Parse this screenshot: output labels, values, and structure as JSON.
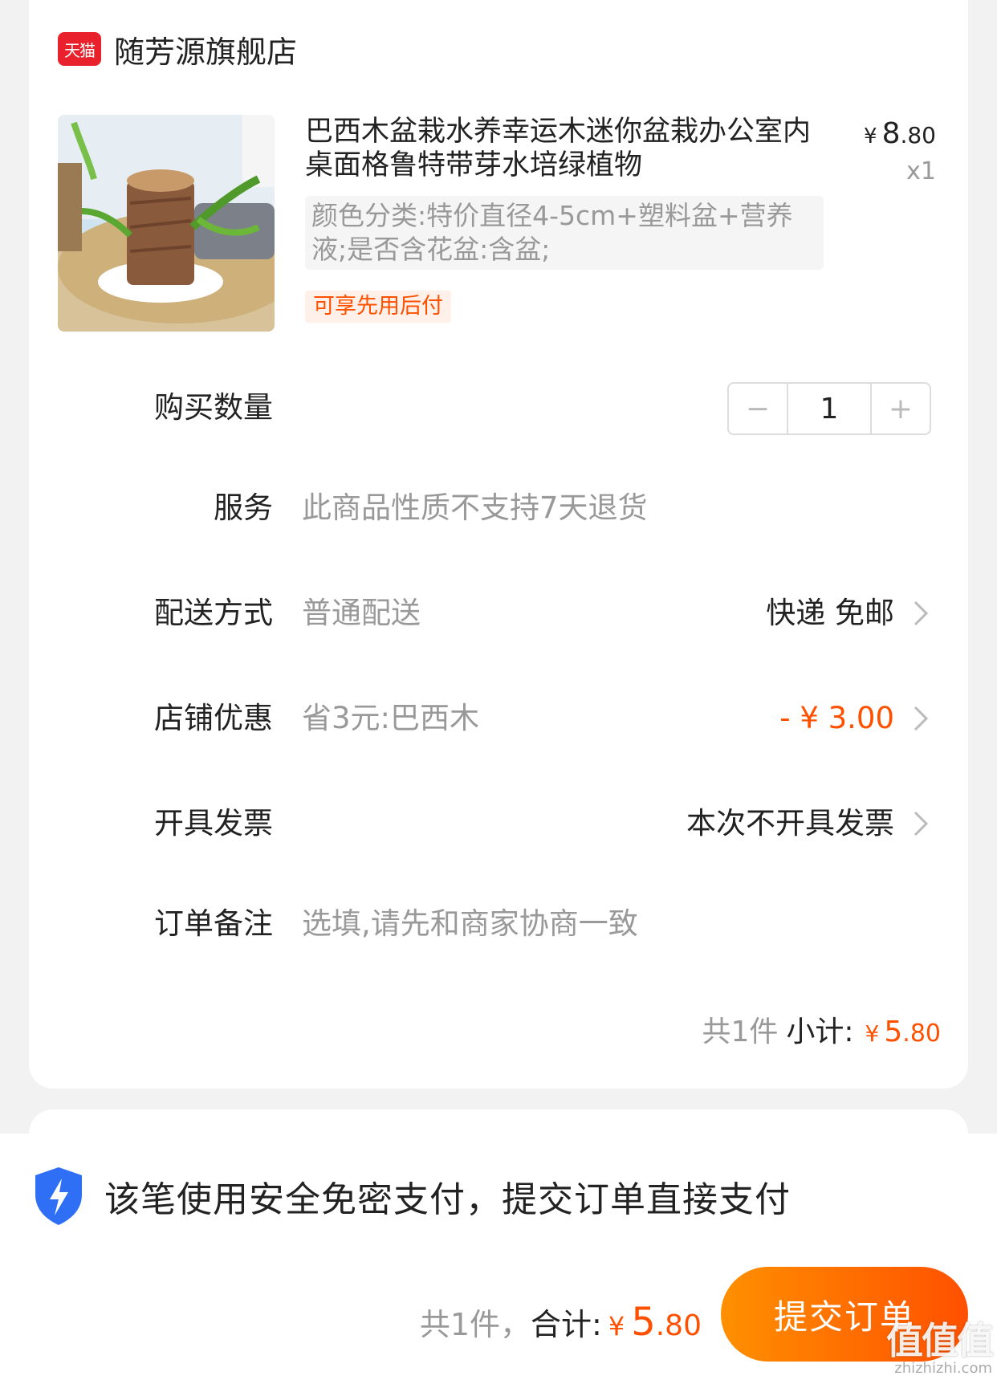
{
  "shop": {
    "badge": "天猫",
    "name": "随芳源旗舰店"
  },
  "product": {
    "title": "巴西木盆栽水养幸运木迷你盆栽办公室内桌面格鲁特带芽水培绿植物",
    "price_symbol": "¥",
    "price_int": "8",
    "price_dec": ".80",
    "quantity_tag": "x1",
    "sku": "颜色分类:特价直径4-5cm+塑料盆+营养液;是否含花盆:含盆;",
    "pay_later_tag": "可享先用后付",
    "image_icon": "plant-photo"
  },
  "quantity": {
    "label": "购买数量",
    "value": "1",
    "minus": "−",
    "plus": "+"
  },
  "service": {
    "label": "服务",
    "value": "此商品性质不支持7天退货"
  },
  "delivery": {
    "label": "配送方式",
    "value": "普通配送",
    "right": "快递 免邮"
  },
  "discount": {
    "label": "店铺优惠",
    "value": "省3元:巴西木",
    "right": "- ¥ 3.00"
  },
  "invoice": {
    "label": "开具发票",
    "right": "本次不开具发票"
  },
  "note": {
    "label": "订单备注",
    "placeholder": "选填,请先和商家协商一致"
  },
  "subtotal": {
    "count": "共1件",
    "label": "小计:",
    "symbol": "¥",
    "int": "5",
    "dec": ".80"
  },
  "footer": {
    "secure_text": "该笔使用安全免密支付，提交订单直接支付",
    "count": "共1件，",
    "label": "合计:",
    "symbol": "¥",
    "int": "5",
    "dec": ".80",
    "submit": "提交订单"
  },
  "watermark": {
    "main": "值值值",
    "sub": "zhizhizhi.com"
  },
  "colors": {
    "accent": "#ff5000",
    "tmall_red": "#e9212d",
    "shield_blue": "#2f6ff5"
  }
}
